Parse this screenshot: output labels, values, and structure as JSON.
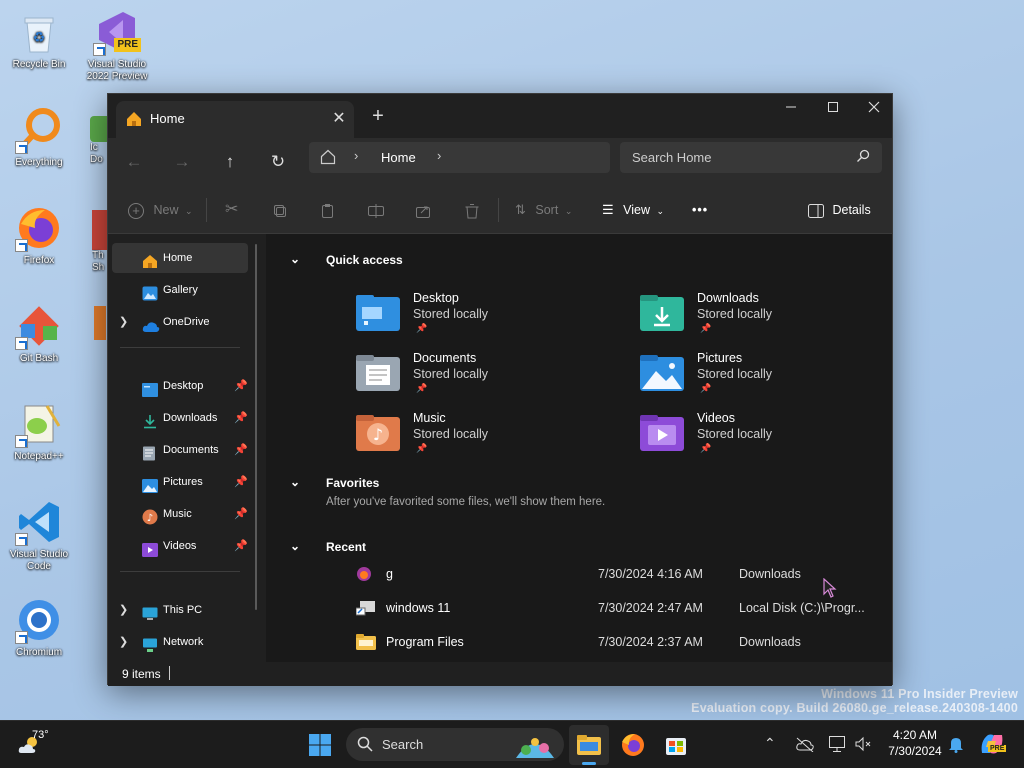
{
  "desktop": {
    "icons": [
      {
        "label": "Recycle Bin"
      },
      {
        "label": "Visual Studio 2022 Preview",
        "badge": "PRE"
      },
      {
        "label": "Everything"
      },
      {
        "label": "Firefox"
      },
      {
        "label": "Git Bash"
      },
      {
        "label": "Notepad++"
      },
      {
        "label": "Visual Studio Code"
      },
      {
        "label": "Chromium"
      }
    ],
    "partial_labels": [
      "Ic",
      "Do",
      "Th",
      "Sh"
    ],
    "watermark": {
      "line1": "Windows 11 Pro Insider Preview",
      "line2": "Evaluation copy. Build 26080.ge_release.240308-1400"
    }
  },
  "window": {
    "tab": {
      "label": "Home",
      "close_icon": "close-icon"
    },
    "new_tab_icon": "plus-icon",
    "controls": {
      "minimize": "minimize-icon",
      "maximize": "maximize-icon",
      "close": "close-icon"
    },
    "address": {
      "breadcrumb": [
        "Home"
      ]
    },
    "search": {
      "placeholder": "Search Home"
    },
    "commands": {
      "new_label": "New",
      "sort_label": "Sort",
      "view_label": "View",
      "more_label": "•••",
      "details_label": "Details"
    },
    "nav": {
      "top": [
        {
          "label": "Home",
          "icon": "home-icon",
          "selected": true
        },
        {
          "label": "Gallery",
          "icon": "gallery-icon"
        },
        {
          "label": "OneDrive",
          "icon": "cloud-icon",
          "expandable": true
        }
      ],
      "pinned": [
        {
          "label": "Desktop",
          "icon": "desktop-folder-icon",
          "color": "#2f8fe0"
        },
        {
          "label": "Downloads",
          "icon": "download-icon",
          "color": "#2fb79c"
        },
        {
          "label": "Documents",
          "icon": "document-icon",
          "color": "#9aa6b2"
        },
        {
          "label": "Pictures",
          "icon": "pictures-icon",
          "color": "#2d8ee0"
        },
        {
          "label": "Music",
          "icon": "music-icon",
          "color": "#e07a4a"
        },
        {
          "label": "Videos",
          "icon": "video-icon",
          "color": "#8d4bd8"
        }
      ],
      "bottom": [
        {
          "label": "This PC",
          "icon": "pc-icon"
        },
        {
          "label": "Network",
          "icon": "network-icon"
        }
      ]
    },
    "quick_access": {
      "title": "Quick access",
      "items": [
        {
          "name": "Desktop",
          "sub": "Stored locally",
          "color": "#2f8fe0",
          "icon": "desktop-folder-icon"
        },
        {
          "name": "Downloads",
          "sub": "Stored locally",
          "color": "#2fb79c",
          "icon": "downloads-folder-icon"
        },
        {
          "name": "Documents",
          "sub": "Stored locally",
          "color": "#9aa6b2",
          "icon": "documents-folder-icon"
        },
        {
          "name": "Pictures",
          "sub": "Stored locally",
          "color": "#2d8ee0",
          "icon": "pictures-folder-icon"
        },
        {
          "name": "Music",
          "sub": "Stored locally",
          "color": "#e07a4a",
          "icon": "music-folder-icon"
        },
        {
          "name": "Videos",
          "sub": "Stored locally",
          "color": "#8d4bd8",
          "icon": "videos-folder-icon"
        }
      ]
    },
    "favorites": {
      "title": "Favorites",
      "empty_text": "After you've favorited some files, we'll show them here."
    },
    "recent": {
      "title": "Recent",
      "items": [
        {
          "name": "g",
          "date": "7/30/2024 4:16 AM",
          "location": "Downloads",
          "icon": "app-icon"
        },
        {
          "name": "windows 11",
          "date": "7/30/2024 2:47 AM",
          "location": "Local Disk (C:)\\Progr...",
          "icon": "shortcut-icon"
        },
        {
          "name": "Program Files",
          "date": "7/30/2024 2:37 AM",
          "location": "Downloads",
          "icon": "folder-icon"
        }
      ]
    },
    "status": {
      "items": "9 items"
    }
  },
  "taskbar": {
    "weather": {
      "temp": "73°"
    },
    "search_label": "Search",
    "clock": {
      "time": "4:20 AM",
      "date": "7/30/2024"
    },
    "copilot_badge": "PRE"
  }
}
